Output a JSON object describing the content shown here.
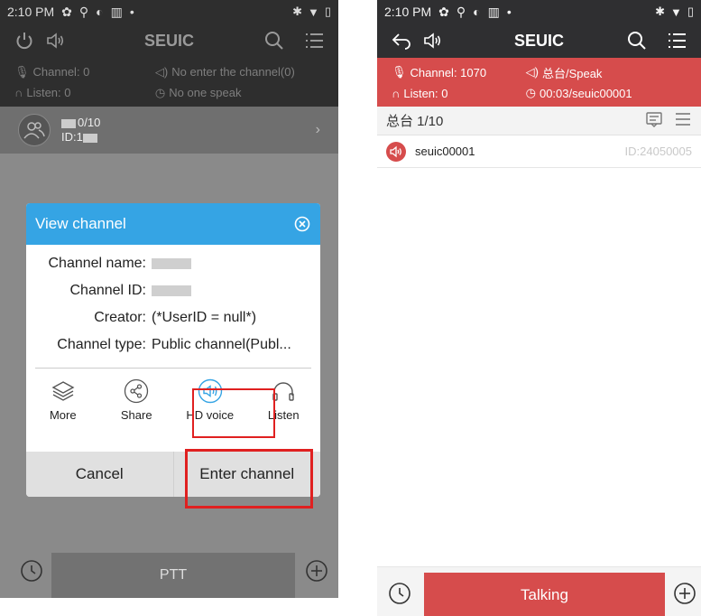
{
  "colors": {
    "dark_bar": "#2e2e2e",
    "dialog_blue": "#35a4e4",
    "speaking_red": "#d64c4c",
    "highlight_red": "#e02020"
  },
  "left": {
    "status": {
      "time": "2:10 PM"
    },
    "titlebar": {
      "title": "SEUIC"
    },
    "info": {
      "channel": "Channel: 0",
      "listen": "Listen: 0",
      "enter_state": "No enter the channel(0)",
      "speak_state": "No one speak"
    },
    "channel_row": {
      "count": "0/10",
      "id_prefix": "ID:1"
    },
    "dialog": {
      "title": "View channel",
      "fields": [
        {
          "label": "Channel name:",
          "value": ""
        },
        {
          "label": "Channel ID:",
          "value": ""
        },
        {
          "label": "Creator:",
          "value": "(*UserID = null*)"
        },
        {
          "label": "Channel type:",
          "value": "Public channel(Publ..."
        }
      ],
      "actions": [
        {
          "label": "More",
          "icon": "layers-icon"
        },
        {
          "label": "Share",
          "icon": "share-icon"
        },
        {
          "label": "HD voice",
          "icon": "speaker-icon"
        },
        {
          "label": "Listen",
          "icon": "headphones-icon"
        }
      ],
      "cancel_label": "Cancel",
      "enter_label": "Enter channel"
    },
    "ptt_label": "PTT"
  },
  "right": {
    "status": {
      "time": "2:10 PM"
    },
    "titlebar": {
      "title": "SEUIC"
    },
    "info": {
      "channel": "Channel: 1070",
      "listen": "Listen: 0",
      "speak_state": "总台/Speak",
      "speaker_time": "00:03/seuic00001"
    },
    "group": {
      "name": "总台 1/10"
    },
    "members": [
      {
        "name": "seuic00001",
        "id": "ID:24050005"
      }
    ],
    "talk_label": "Talking"
  }
}
